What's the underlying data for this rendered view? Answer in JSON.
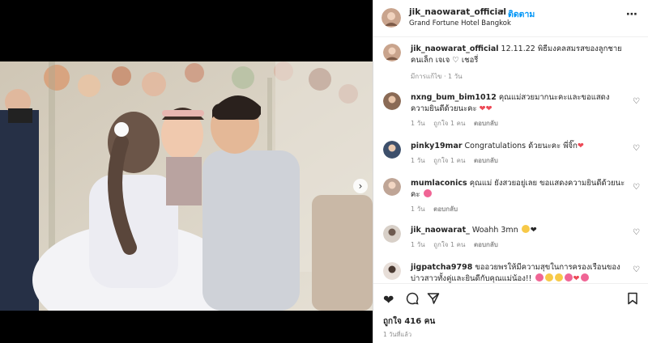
{
  "post": {
    "author": "jik_naowarat_official",
    "separator": "•",
    "follow_label": "ติดตาม",
    "location": "Grand Fortune Hotel Bangkok",
    "more_icon": "more-horizontal-icon",
    "next_icon": "chevron-right-icon"
  },
  "caption": {
    "username": "jik_naowarat_official",
    "text": "12.11.22 พิธีมงคลสมรสของลูกชายคนเล็ก เจเจ ♡ เชอรี่",
    "meta": "มีการแก้ไข · 1 วัน"
  },
  "comments": [
    {
      "username": "nxng_bum_bim1012",
      "text": "คุณแม่สวยมากนะคะและขอแสดงความยินดีด้วยนะคะ",
      "time": "1 วัน",
      "likes": "ถูกใจ 1 คน",
      "reply": "ตอบกลับ"
    },
    {
      "username": "pinky19mar",
      "text": "Congratulations ด้วยนะคะ พี่จิ๊ก",
      "time": "1 วัน",
      "likes": "ถูกใจ 1 คน",
      "reply": "ตอบกลับ"
    },
    {
      "username": "mumlaconics",
      "text": "คุณแม่ ยังสวยอยู่เลย ขอแสดงความยินดีด้วยนะคะ",
      "time": "1 วัน",
      "likes": "",
      "reply": "ตอบกลับ"
    },
    {
      "username": "jik_naowarat_",
      "text": "Woahh 3mn",
      "time": "1 วัน",
      "likes": "ถูกใจ 1 คน",
      "reply": "ตอบกลับ"
    },
    {
      "username": "jigpatcha9798",
      "text": "ขออวยพรให้มีความสุขในการครองเรือนของบ่าวสาวทั้งคู่และยินดีกับคุณแม่น้อง!!",
      "time": "",
      "likes": "",
      "reply": ""
    }
  ],
  "actions": {
    "likes_count": "ถูกใจ 416 คน",
    "posted_ago": "1 วันที่แล้ว"
  },
  "colors": {
    "accent": "#0095f6",
    "heart": "#ed4956",
    "muted": "#8e8e8e",
    "text": "#262626"
  }
}
